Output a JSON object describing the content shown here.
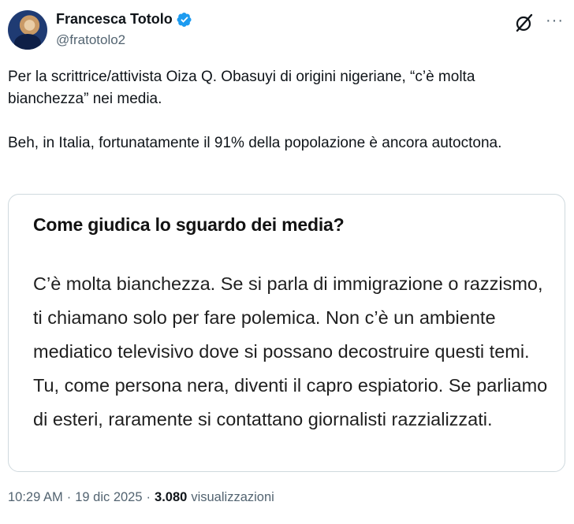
{
  "author": {
    "display_name": "Francesca Totolo",
    "handle": "@fratotolo2",
    "verified": true,
    "avatar_icon": "avatar"
  },
  "tweet": {
    "paragraph_1": "Per la scrittrice/attivista Oiza Q. Obasuyi di origini nigeriane, “c’è molta bianchezza” nei media.",
    "paragraph_2": "Beh, in Italia, fortunatamente il 91% della popolazione è ancora autoctona."
  },
  "media": {
    "title": "Come giudica lo sguardo dei media?",
    "body": "C’è molta bianchezza. Se si parla di immigrazione o razzismo, ti chiamano solo per fare polemica. Non c’è un ambiente mediatico televisivo dove si possano decostruire questi temi. Tu, come persona nera, diventi il capro espiatorio. Se parliamo di esteri, raramente si contattano giornalisti razzializzati."
  },
  "meta": {
    "time": "10:29 AM",
    "sep": "·",
    "date": "19 dic 2025",
    "views_count": "3.080",
    "views_label": "visualizzazioni"
  },
  "colors": {
    "verified": "#1d9bf0",
    "secondary_text": "#536471",
    "border": "#cfd9de"
  },
  "icons": [
    "verified-badge-icon",
    "grok-icon",
    "more-icon"
  ]
}
